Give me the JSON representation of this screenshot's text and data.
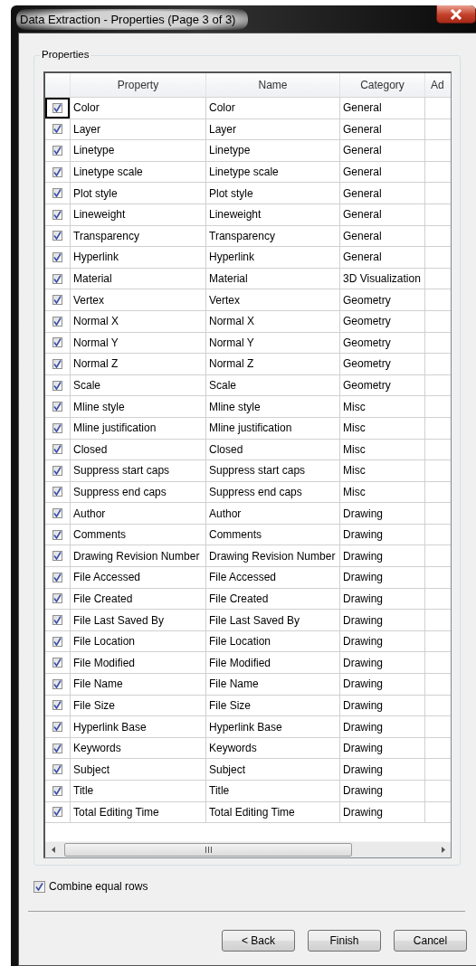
{
  "window": {
    "title": "Data Extraction - Properties (Page 3 of 3)"
  },
  "group": {
    "title": "Properties"
  },
  "table": {
    "columns": [
      "Property",
      "Name",
      "Category",
      "Ad"
    ],
    "rows": [
      {
        "checked": true,
        "focused": true,
        "property": "Color",
        "name": "Color",
        "category": "General"
      },
      {
        "checked": true,
        "focused": false,
        "property": "Layer",
        "name": "Layer",
        "category": "General"
      },
      {
        "checked": true,
        "focused": false,
        "property": "Linetype",
        "name": "Linetype",
        "category": "General"
      },
      {
        "checked": true,
        "focused": false,
        "property": "Linetype scale",
        "name": "Linetype scale",
        "category": "General"
      },
      {
        "checked": true,
        "focused": false,
        "property": "Plot style",
        "name": "Plot style",
        "category": "General"
      },
      {
        "checked": true,
        "focused": false,
        "property": "Lineweight",
        "name": "Lineweight",
        "category": "General"
      },
      {
        "checked": true,
        "focused": false,
        "property": "Transparency",
        "name": "Transparency",
        "category": "General"
      },
      {
        "checked": true,
        "focused": false,
        "property": "Hyperlink",
        "name": "Hyperlink",
        "category": "General"
      },
      {
        "checked": true,
        "focused": false,
        "property": "Material",
        "name": "Material",
        "category": "3D Visualization"
      },
      {
        "checked": true,
        "focused": false,
        "property": "Vertex",
        "name": "Vertex",
        "category": "Geometry"
      },
      {
        "checked": true,
        "focused": false,
        "property": "Normal  X",
        "name": "Normal  X",
        "category": "Geometry"
      },
      {
        "checked": true,
        "focused": false,
        "property": "Normal  Y",
        "name": "Normal  Y",
        "category": "Geometry"
      },
      {
        "checked": true,
        "focused": false,
        "property": "Normal  Z",
        "name": "Normal  Z",
        "category": "Geometry"
      },
      {
        "checked": true,
        "focused": false,
        "property": "Scale",
        "name": "Scale",
        "category": "Geometry"
      },
      {
        "checked": true,
        "focused": false,
        "property": "Mline style",
        "name": "Mline style",
        "category": "Misc"
      },
      {
        "checked": true,
        "focused": false,
        "property": "Mline justification",
        "name": "Mline justification",
        "category": "Misc"
      },
      {
        "checked": true,
        "focused": false,
        "property": "Closed",
        "name": "Closed",
        "category": "Misc"
      },
      {
        "checked": true,
        "focused": false,
        "property": "Suppress start caps",
        "name": "Suppress start caps",
        "category": "Misc"
      },
      {
        "checked": true,
        "focused": false,
        "property": "Suppress end caps",
        "name": "Suppress end caps",
        "category": "Misc"
      },
      {
        "checked": true,
        "focused": false,
        "property": "Author",
        "name": "Author",
        "category": "Drawing"
      },
      {
        "checked": true,
        "focused": false,
        "property": "Comments",
        "name": "Comments",
        "category": "Drawing"
      },
      {
        "checked": true,
        "focused": false,
        "property": "Drawing Revision Number",
        "name": "Drawing Revision Number",
        "category": "Drawing"
      },
      {
        "checked": true,
        "focused": false,
        "property": "File Accessed",
        "name": "File Accessed",
        "category": "Drawing"
      },
      {
        "checked": true,
        "focused": false,
        "property": "File Created",
        "name": "File Created",
        "category": "Drawing"
      },
      {
        "checked": true,
        "focused": false,
        "property": "File Last Saved By",
        "name": "File Last Saved By",
        "category": "Drawing"
      },
      {
        "checked": true,
        "focused": false,
        "property": "File Location",
        "name": "File Location",
        "category": "Drawing"
      },
      {
        "checked": true,
        "focused": false,
        "property": "File Modified",
        "name": "File Modified",
        "category": "Drawing"
      },
      {
        "checked": true,
        "focused": false,
        "property": "File Name",
        "name": "File Name",
        "category": "Drawing"
      },
      {
        "checked": true,
        "focused": false,
        "property": "File Size",
        "name": "File Size",
        "category": "Drawing"
      },
      {
        "checked": true,
        "focused": false,
        "property": "Hyperlink Base",
        "name": "Hyperlink Base",
        "category": "Drawing"
      },
      {
        "checked": true,
        "focused": false,
        "property": "Keywords",
        "name": "Keywords",
        "category": "Drawing"
      },
      {
        "checked": true,
        "focused": false,
        "property": "Subject",
        "name": "Subject",
        "category": "Drawing"
      },
      {
        "checked": true,
        "focused": false,
        "property": "Title",
        "name": "Title",
        "category": "Drawing"
      },
      {
        "checked": true,
        "focused": false,
        "property": "Total Editing Time",
        "name": "Total Editing Time",
        "category": "Drawing"
      }
    ]
  },
  "combine": {
    "label": "Combine equal rows",
    "checked": true
  },
  "buttons": [
    "< Back",
    "Finish",
    "Cancel"
  ]
}
